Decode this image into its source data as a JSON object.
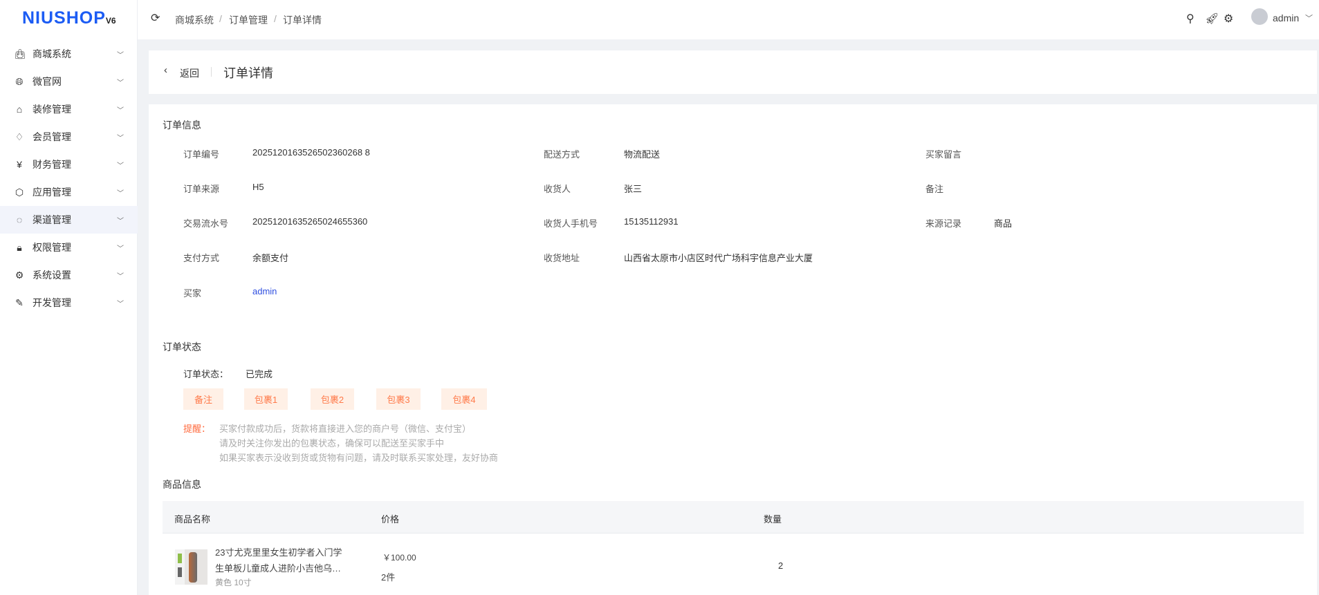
{
  "logo": {
    "text": "NIUSHOP",
    "version": "V6"
  },
  "sidebar": {
    "items": [
      {
        "label": "商城系统",
        "icon": "bag-icon"
      },
      {
        "label": "微官网",
        "icon": "globe-icon"
      },
      {
        "label": "装修管理",
        "icon": "decor-icon"
      },
      {
        "label": "会员管理",
        "icon": "diamond-icon"
      },
      {
        "label": "财务管理",
        "icon": "finance-icon"
      },
      {
        "label": "应用管理",
        "icon": "cube-icon"
      },
      {
        "label": "渠道管理",
        "icon": "channel-icon"
      },
      {
        "label": "权限管理",
        "icon": "lock-icon"
      },
      {
        "label": "系统设置",
        "icon": "gear-icon"
      },
      {
        "label": "开发管理",
        "icon": "edit-icon"
      }
    ]
  },
  "header": {
    "breadcrumb": [
      "商城系统",
      "订单管理",
      "订单详情"
    ],
    "user": "admin"
  },
  "page": {
    "back": "返回",
    "title": "订单详情"
  },
  "order_info": {
    "title": "订单信息",
    "col1": [
      {
        "label": "订单编号",
        "value": "2025120163526502360268 8"
      },
      {
        "label": "订单来源",
        "value": "H5"
      },
      {
        "label": "交易流水号",
        "value": "20251201635265024655360"
      },
      {
        "label": "支付方式",
        "value": "余额支付"
      },
      {
        "label": "买家",
        "value": "admin"
      }
    ],
    "col2": [
      {
        "label": "配送方式",
        "value": "物流配送"
      },
      {
        "label": "收货人",
        "value": "张三"
      },
      {
        "label": "收货人手机号",
        "value": "15135112931"
      },
      {
        "label": "收货地址",
        "value": "山西省太原市小店区时代广场科宇信息产业大厦"
      }
    ],
    "col3": [
      {
        "label": "买家留言",
        "value": ""
      },
      {
        "label": "备注",
        "value": ""
      },
      {
        "label": "来源记录",
        "value": "商品"
      }
    ]
  },
  "order_status": {
    "title": "订单状态",
    "label": "订单状态：",
    "value": "已完成",
    "buttons": [
      "备注",
      "包裹1",
      "包裹2",
      "包裹3",
      "包裹4"
    ],
    "tip_label": "提醒：",
    "tips": [
      "买家付款成功后，货款将直接进入您的商户号（微信、支付宝）",
      "请及时关注你发出的包裹状态，确保可以配送至买家手中",
      "如果买家表示没收到货或货物有问题，请及时联系买家处理，友好协商"
    ]
  },
  "goods": {
    "title": "商品信息",
    "columns": [
      "商品名称",
      "价格",
      "数量"
    ],
    "rows": [
      {
        "name_line1": "23寸尤克里里女生初学者入门学",
        "name_line2": "生单板儿童成人进阶小吉他乌…",
        "spec": "黄色 10寸",
        "price": "￥100.00",
        "count": "2件",
        "quantity": "2"
      }
    ]
  }
}
